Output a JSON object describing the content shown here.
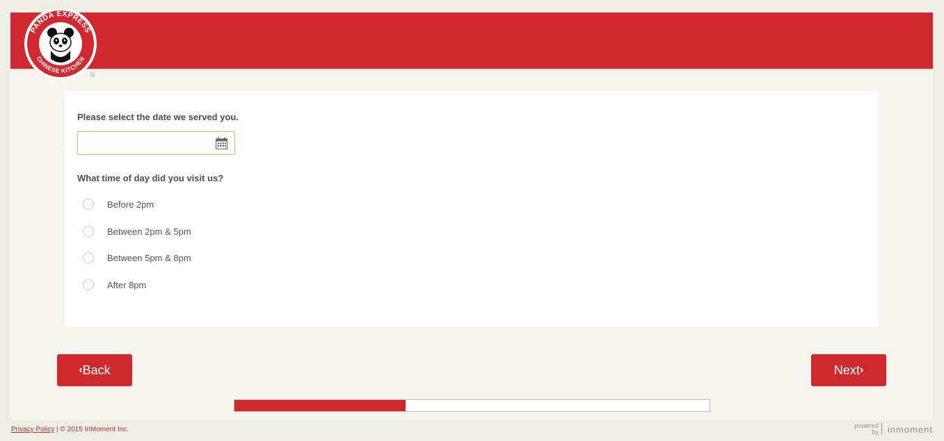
{
  "header": {
    "brand_name": "PANDA EXPRESS",
    "brand_sub": "CHINESE KITCHEN"
  },
  "survey": {
    "date_question": "Please select the date we served you.",
    "date_value": "",
    "time_question": "What time of day did you visit us?",
    "time_options": [
      "Before 2pm",
      "Between 2pm & 5pm",
      "Between 5pm & 8pm",
      "After 8pm"
    ]
  },
  "nav": {
    "back_label": "Back",
    "next_label": "Next"
  },
  "progress": {
    "fraction": 0.36
  },
  "footer": {
    "privacy_label": "Privacy Policy",
    "copyright": "| © 2015 InMoment Inc."
  },
  "powered": {
    "powered_text": "powered",
    "by_text": "by",
    "brand": "inmoment"
  },
  "colors": {
    "brand_red": "#d1292f",
    "button_red": "#cd2a2e"
  }
}
